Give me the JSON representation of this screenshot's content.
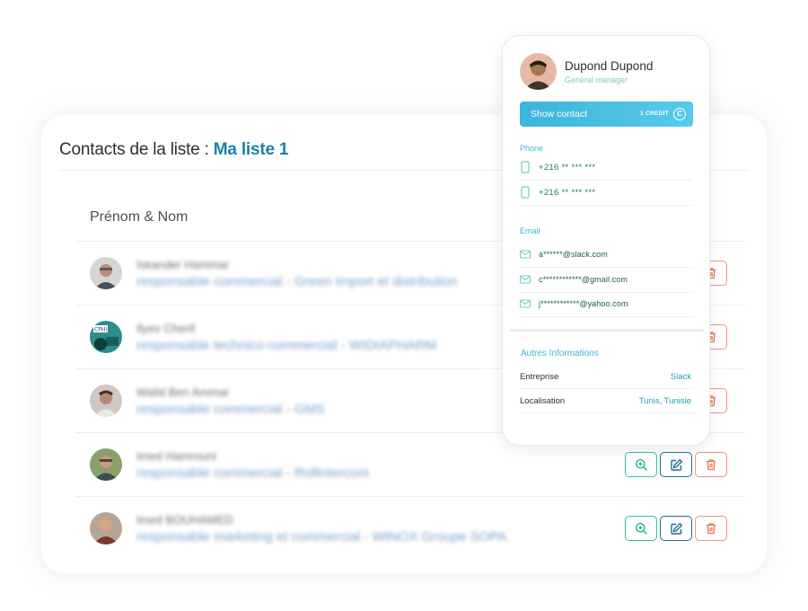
{
  "header": {
    "title_prefix": "Contacts de la liste : ",
    "list_name": "Ma liste 1"
  },
  "table": {
    "column_header": "Prénom & Nom",
    "rows": [
      {
        "name": "Iskander Hammar",
        "title": "responsable commercial - Green Import et distribution",
        "avatar_bg": "#c9c2bc",
        "show_actions": false
      },
      {
        "name": "Ilyes Cherif",
        "title": "responsable technico-commercial - WIDIAPHARM",
        "avatar_bg": "#2a8e8a",
        "show_actions": false
      },
      {
        "name": "Walid Ben Ammar",
        "title": "responsable commercial - GMS",
        "avatar_bg": "#b9ada4",
        "show_actions": false
      },
      {
        "name": "Imed Hamrouni",
        "title": "responsable commercial - Rollintercom",
        "avatar_bg": "#7c8e63",
        "show_actions": true
      },
      {
        "name": "Imed BOUHAMED",
        "title": "responsable marketing et commercial - WINOX Groupe SOPA",
        "avatar_bg": "#a9927e",
        "show_actions": true
      }
    ]
  },
  "popup": {
    "name": "Dupond Dupond",
    "role": "General manager",
    "show_contact_label": "Show contact",
    "credit_label": "1 CREDIT",
    "coin_symbol": "C",
    "phone_label": "Phone",
    "phones": [
      "+216 ** *** ***",
      "+216 ** *** ***"
    ],
    "email_label": "Email",
    "emails": [
      "a******@slack.com",
      "c************@gmail.com",
      "j************@yahoo.com"
    ],
    "other_info_title": "Autres Informations",
    "company_label": "Entreprise",
    "company_value": "Slack",
    "location_label": "Localisation",
    "location_value": "Tunis, Tunisie"
  },
  "colors": {
    "accent": "#3cb6d6",
    "view": "#22b496",
    "edit": "#1d6f8f",
    "delete": "#e8734f",
    "list_name": "#1f7fa6"
  }
}
